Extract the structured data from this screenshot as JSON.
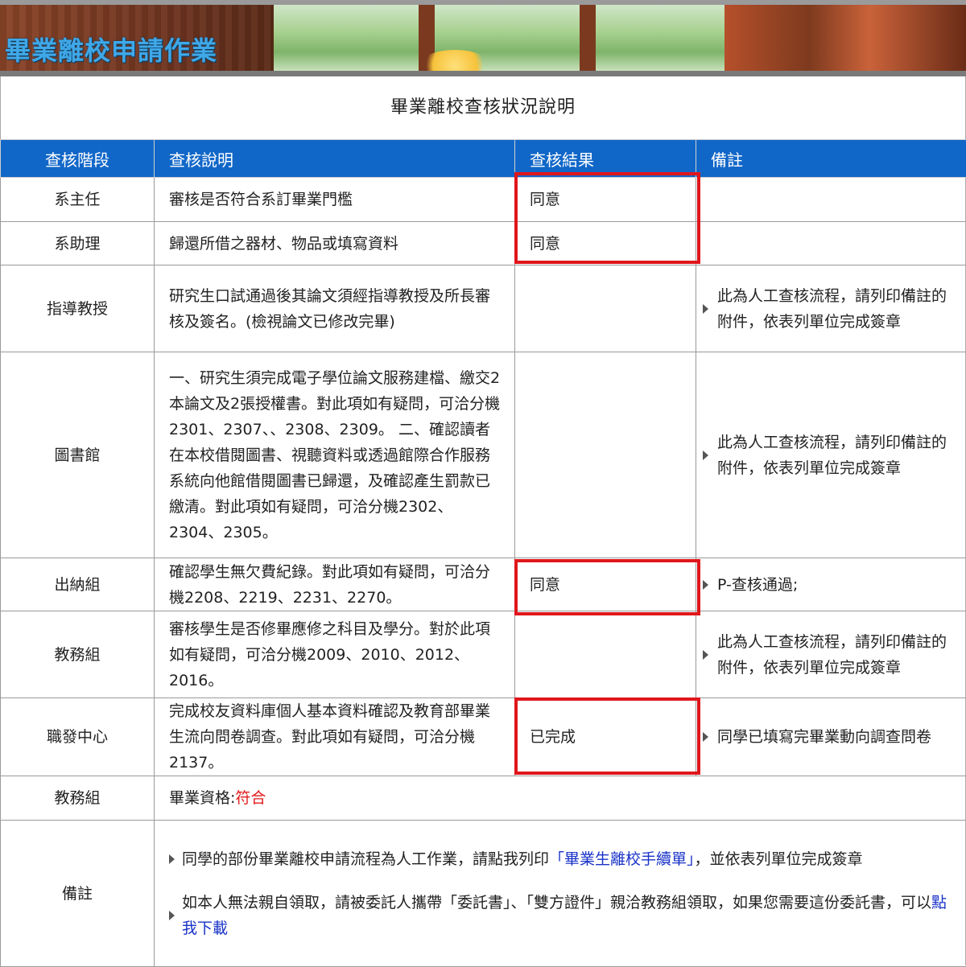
{
  "banner": {
    "title": "畢業離校申請作業"
  },
  "page": {
    "heading": "畢業離校查核狀況說明"
  },
  "table": {
    "headers": {
      "stage": "查核階段",
      "description": "查核說明",
      "result": "查核結果",
      "note": "備註"
    },
    "rows": [
      {
        "stage": "系主任",
        "description": "審核是否符合系訂畢業門檻",
        "result": "同意",
        "note": ""
      },
      {
        "stage": "系助理",
        "description": "歸還所借之器材、物品或填寫資料",
        "result": "同意",
        "note": ""
      },
      {
        "stage": "指導教授",
        "description": "研究生口試通過後其論文須經指導教授及所長審核及簽名。(檢視論文已修改完畢)",
        "result": "",
        "note": "此為人工查核流程，請列印備註的附件，依表列單位完成簽章"
      },
      {
        "stage": "圖書館",
        "description": "一、研究生須完成電子學位論文服務建檔、繳交2本論文及2張授權書。對此項如有疑問，可洽分機2301、2307、、2308、2309。 二、確認讀者在本校借閱圖書、視聽資料或透過館際合作服務系統向他館借閱圖書已歸還，及確認產生罰款已繳清。對此項如有疑問，可洽分機2302、2304、2305。",
        "result": "",
        "note": "此為人工查核流程，請列印備註的附件，依表列單位完成簽章"
      },
      {
        "stage": "出納組",
        "description": "確認學生無欠費紀錄。對此項如有疑問，可洽分機2208、2219、2231、2270。",
        "result": "同意",
        "note": "P-查核通過;"
      },
      {
        "stage": "教務組",
        "description": "審核學生是否修畢應修之科目及學分。對於此項如有疑問，可洽分機2009、2010、2012、2016。",
        "result": "",
        "note": "此為人工查核流程，請列印備註的附件，依表列單位完成簽章"
      },
      {
        "stage": "職發中心",
        "description": "完成校友資料庫個人基本資料確認及教育部畢業生流向問卷調查。對此項如有疑問，可洽分機2137。",
        "result": "已完成",
        "note": "同學已填寫完畢業動向調查問卷"
      }
    ],
    "qualification": {
      "stage": "教務組",
      "label": "畢業資格:",
      "value": "符合"
    },
    "remarks": {
      "stage": "備註",
      "item1": {
        "before": "同學的部份畢業離校申請流程為人工作業，請點我列印",
        "link": "「畢業生離校手續單」",
        "after": "，並依表列單位完成簽章"
      },
      "item2": {
        "before": "如本人無法親自領取，請被委託人攜帶「委託書」、「雙方證件」親洽教務組領取，如果您需要這份委託書，可以",
        "link": "點我下載"
      }
    }
  },
  "colors": {
    "header_bg": "#1167c8",
    "result_text": "#e01b1b",
    "highlight": "#e0161c",
    "link": "#1a33c8"
  }
}
